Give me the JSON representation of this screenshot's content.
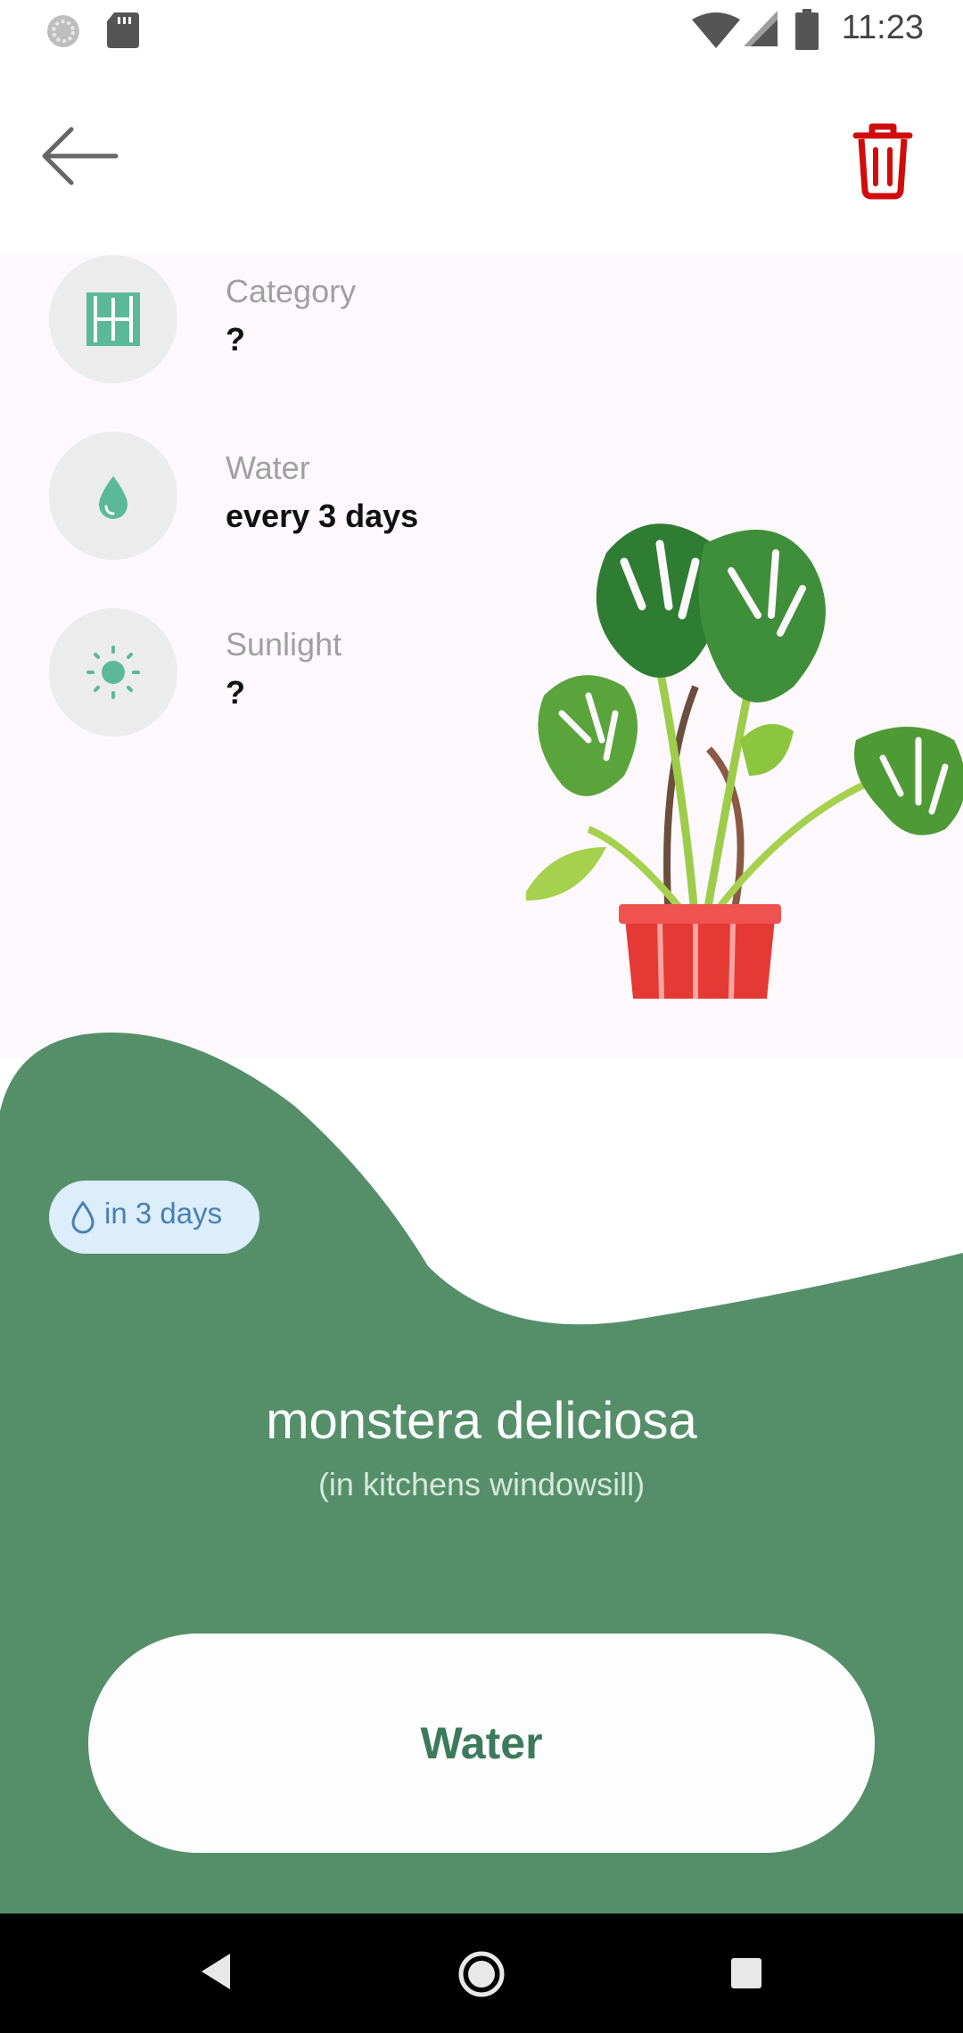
{
  "status_bar": {
    "time": "11:23"
  },
  "colors": {
    "accent_green": "#558f69",
    "delete_red": "#d10c0c",
    "badge_blue": "#dcedfb"
  },
  "app_bar": {
    "back_icon": "arrow-left-icon",
    "delete_icon": "trash-icon"
  },
  "details": [
    {
      "icon": "window-icon",
      "label": "Category",
      "value": "?"
    },
    {
      "icon": "water-drop-icon",
      "label": "Water",
      "value": "every 3 days"
    },
    {
      "icon": "sun-icon",
      "label": "Sunlight",
      "value": "?"
    }
  ],
  "badge": {
    "icon": "water-drop-outline-icon",
    "label": "in 3 days"
  },
  "plant": {
    "name": "monstera deliciosa",
    "location": "(in kitchens windowsill)"
  },
  "actions": {
    "water_label": "Water"
  }
}
